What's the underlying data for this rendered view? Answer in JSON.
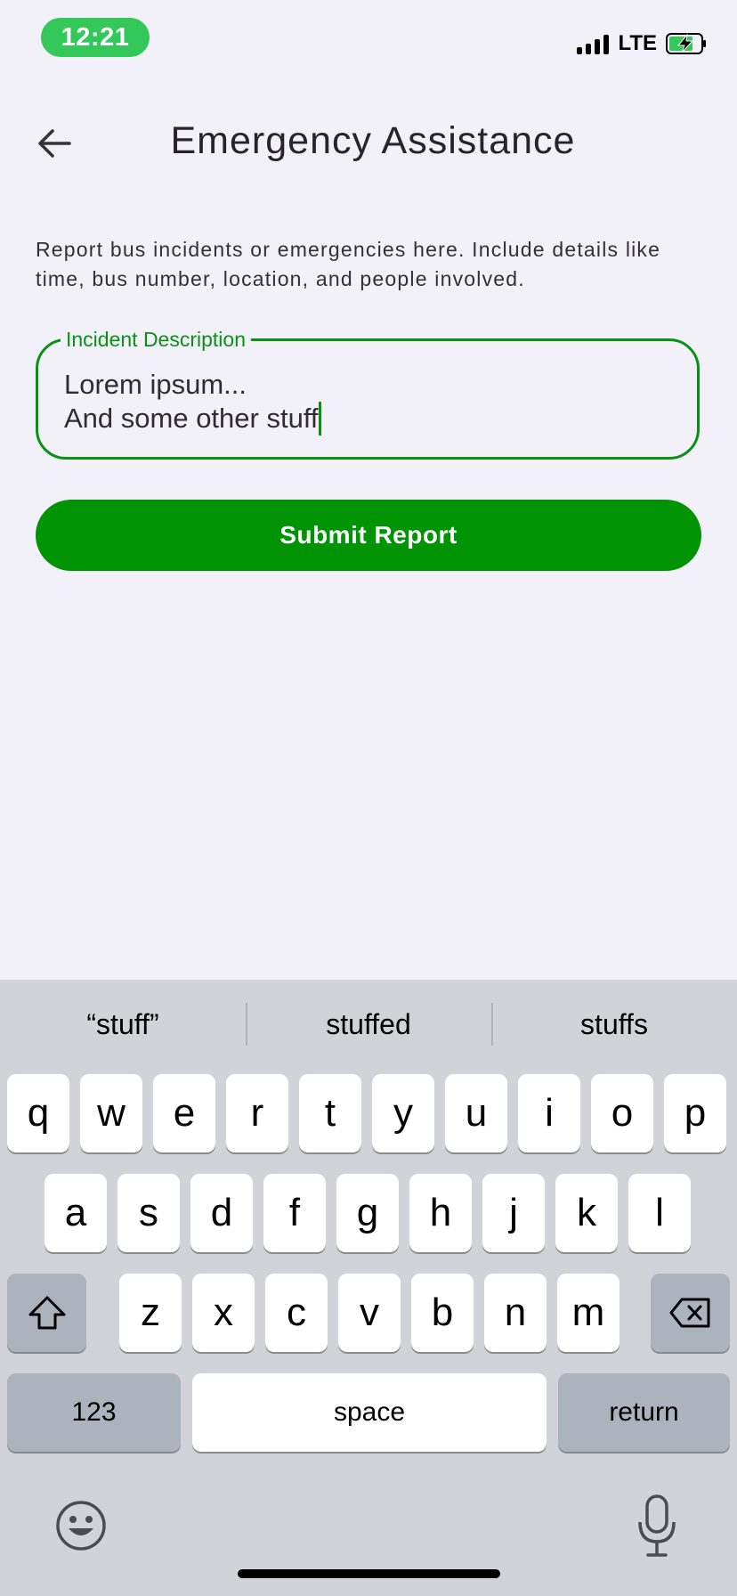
{
  "status_bar": {
    "time": "12:21",
    "network": "LTE"
  },
  "app_bar": {
    "title": "Emergency Assistance"
  },
  "description": "Report bus incidents or emergencies here. Include details like time, bus number, location, and people involved.",
  "incident_field": {
    "label": "Incident Description",
    "line1": "Lorem ipsum...",
    "line2": "And some other stuff"
  },
  "submit_label": "Submit Report",
  "keyboard": {
    "suggestions": [
      "“stuff”",
      "stuffed",
      "stuffs"
    ],
    "row1": [
      "q",
      "w",
      "e",
      "r",
      "t",
      "y",
      "u",
      "i",
      "o",
      "p"
    ],
    "row2": [
      "a",
      "s",
      "d",
      "f",
      "g",
      "h",
      "j",
      "k",
      "l"
    ],
    "row3": [
      "z",
      "x",
      "c",
      "v",
      "b",
      "n",
      "m"
    ],
    "numbers_label": "123",
    "space_label": "space",
    "return_label": "return"
  },
  "colors": {
    "accent": "#0a9113",
    "button": "#009404",
    "status_pill": "#34c759"
  }
}
